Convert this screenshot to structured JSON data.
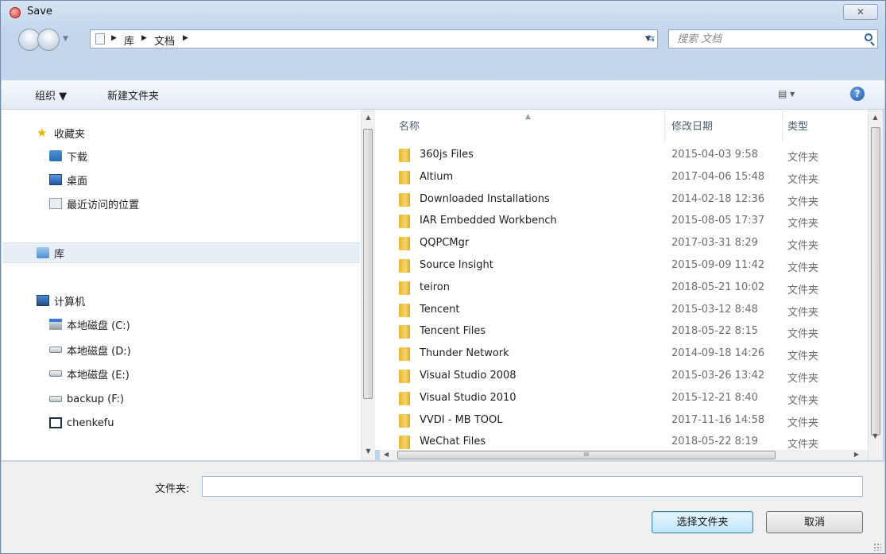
{
  "window": {
    "title": "Save",
    "close_label": "✕"
  },
  "nav": {
    "breadcrumbs": [
      "库",
      "文档"
    ],
    "search_placeholder": "搜索 文档"
  },
  "toolbar": {
    "organize_label": "组织 ▼",
    "new_folder_label": "新建文件夹",
    "view_label": "▤ ▾",
    "help_label": "?"
  },
  "sidebar": {
    "favorites": {
      "label": "收藏夹",
      "items": [
        "下载",
        "桌面",
        "最近访问的位置"
      ]
    },
    "library": "库",
    "computer": {
      "label": "计算机",
      "items": [
        "本地磁盘 (C:)",
        "本地磁盘 (D:)",
        "本地磁盘 (E:)",
        "backup (F:)",
        "chenkefu"
      ]
    }
  },
  "columns": {
    "name": "名称",
    "date": "修改日期",
    "type": "类型"
  },
  "files": [
    {
      "name": "360js Files",
      "date": "2015-04-03 9:58",
      "type": "文件夹"
    },
    {
      "name": "Altium",
      "date": "2017-04-06 15:48",
      "type": "文件夹"
    },
    {
      "name": "Downloaded Installations",
      "date": "2014-02-18 12:36",
      "type": "文件夹"
    },
    {
      "name": "IAR Embedded Workbench",
      "date": "2015-08-05 17:37",
      "type": "文件夹"
    },
    {
      "name": "QQPCMgr",
      "date": "2017-03-31 8:29",
      "type": "文件夹"
    },
    {
      "name": "Source Insight",
      "date": "2015-09-09 11:42",
      "type": "文件夹"
    },
    {
      "name": "teiron",
      "date": "2018-05-21 10:02",
      "type": "文件夹"
    },
    {
      "name": "Tencent",
      "date": "2015-03-12 8:48",
      "type": "文件夹"
    },
    {
      "name": "Tencent Files",
      "date": "2018-05-22 8:15",
      "type": "文件夹"
    },
    {
      "name": "Thunder Network",
      "date": "2014-09-18 14:26",
      "type": "文件夹"
    },
    {
      "name": "Visual Studio 2008",
      "date": "2015-03-26 13:42",
      "type": "文件夹"
    },
    {
      "name": "Visual Studio 2010",
      "date": "2015-12-21 8:40",
      "type": "文件夹"
    },
    {
      "name": "VVDI - MB TOOL",
      "date": "2017-11-16 14:58",
      "type": "文件夹"
    },
    {
      "name": "WeChat Files",
      "date": "2018-05-22 8:19",
      "type": "文件夹"
    }
  ],
  "footer": {
    "folder_label": "文件夹:",
    "folder_value": "",
    "select_button": "选择文件夹",
    "cancel_button": "取消"
  }
}
